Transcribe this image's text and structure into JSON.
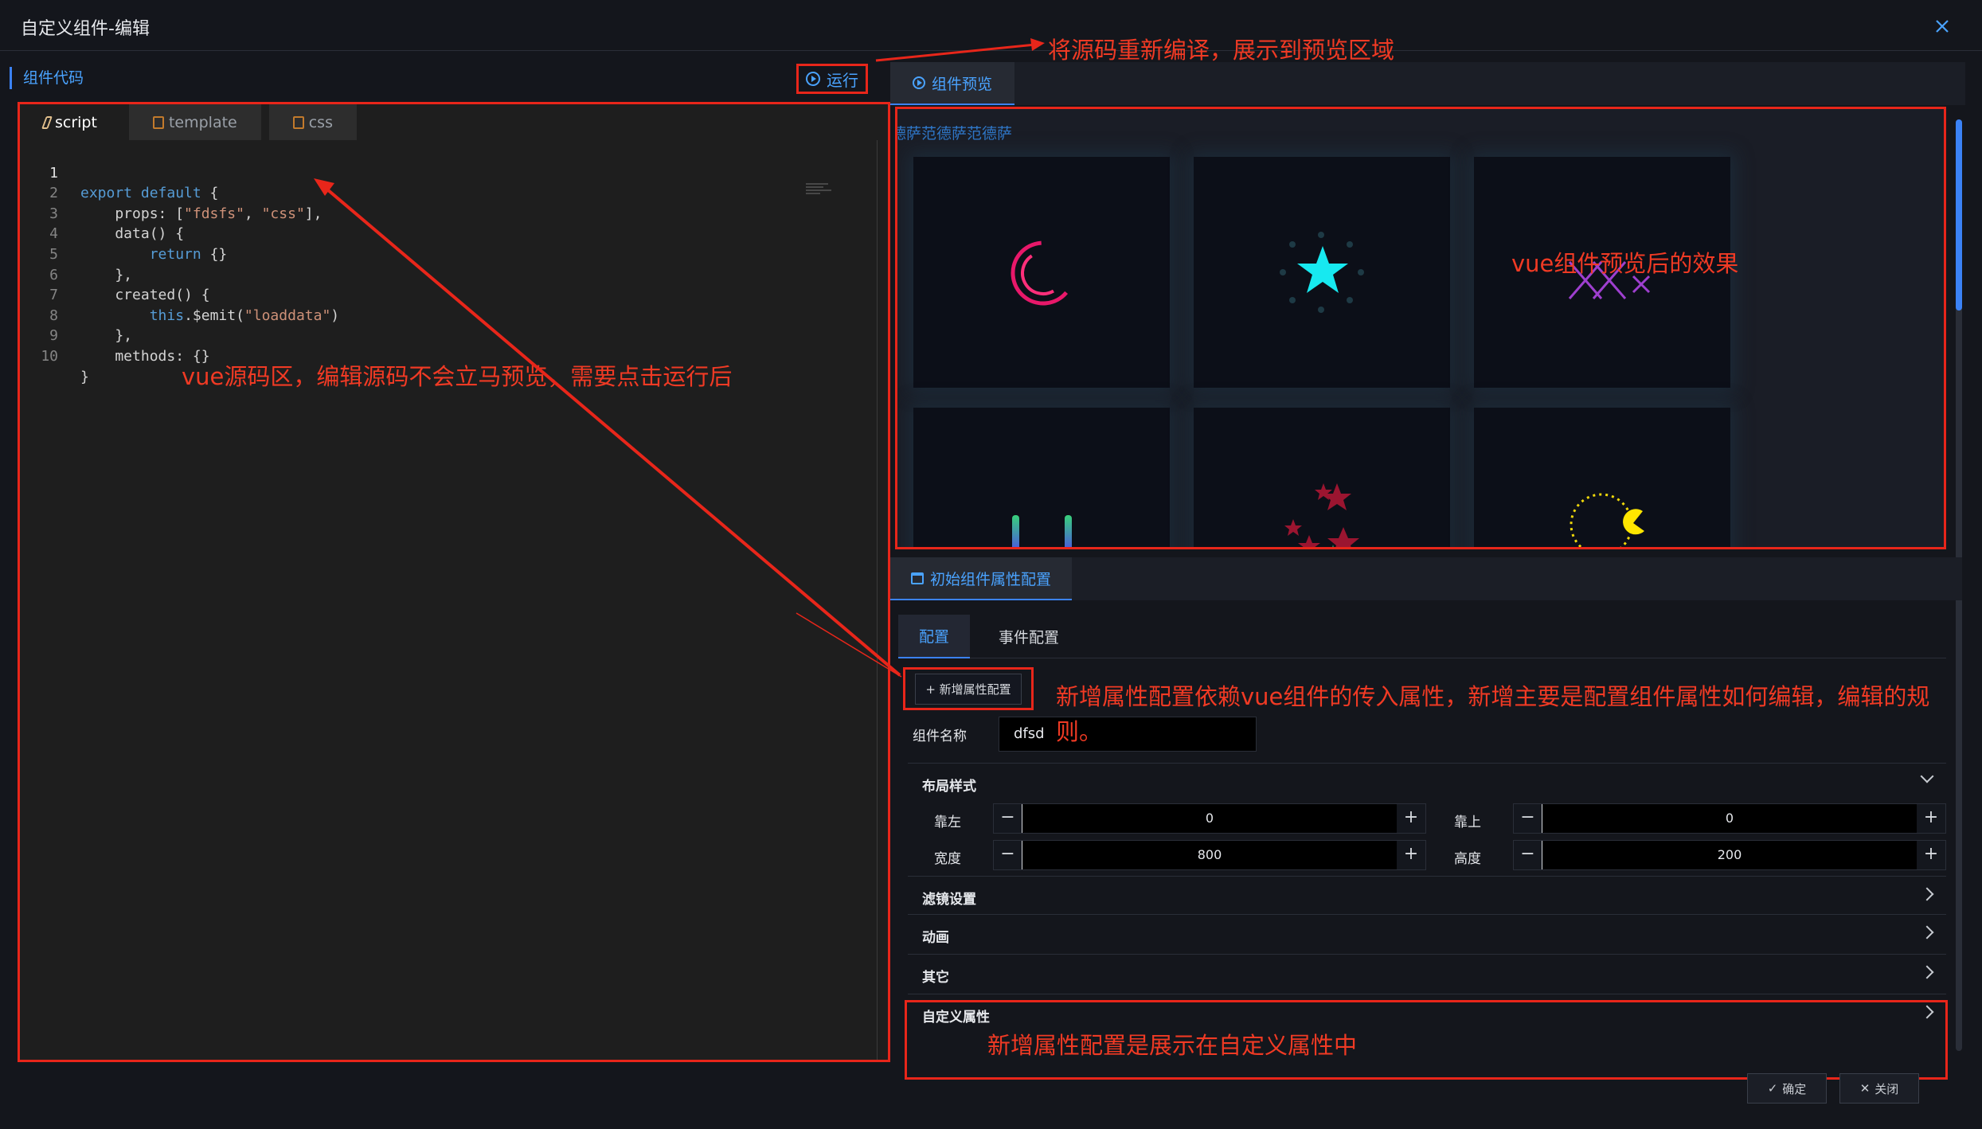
{
  "dialog": {
    "title": "自定义组件-编辑"
  },
  "left": {
    "section_label": "组件代码",
    "run_label": "运行",
    "tabs": [
      {
        "label": "script"
      },
      {
        "label": "template"
      },
      {
        "label": "css"
      }
    ],
    "code_lines": [
      {
        "n": "1",
        "text": "export default {"
      },
      {
        "n": "2",
        "text": "    props: [\"fdsfs\", \"css\"],"
      },
      {
        "n": "3",
        "text": "    data() {"
      },
      {
        "n": "4",
        "text": "        return {}"
      },
      {
        "n": "5",
        "text": "    },"
      },
      {
        "n": "6",
        "text": "    created() {"
      },
      {
        "n": "7",
        "text": "        this.$emit(\"loaddata\")"
      },
      {
        "n": "8",
        "text": "    },"
      },
      {
        "n": "9",
        "text": "    methods: {}"
      },
      {
        "n": "10",
        "text": "}"
      }
    ]
  },
  "right": {
    "preview_tab": "组件预览",
    "preview_text": "德萨范德萨范德萨",
    "config_tab": "初始组件属性配置",
    "subtabs": [
      "配置",
      "事件配置"
    ],
    "add_button": "+ 新增属性配置",
    "name_label": "组件名称",
    "name_value": "dfsd",
    "layout_section": "布局样式",
    "fields": {
      "left_label": "靠左",
      "left_value": "0",
      "top_label": "靠上",
      "top_value": "0",
      "width_label": "宽度",
      "width_value": "800",
      "height_label": "高度",
      "height_value": "200"
    },
    "sections": [
      "滤镜设置",
      "动画",
      "其它",
      "自定义属性"
    ],
    "confirm": "确定",
    "close": "关闭"
  },
  "annotations": {
    "run": "将源码重新编译，展示到预览区域",
    "preview": "vue组件预览后的效果",
    "code": "vue源码区，编辑源码不会立马预览，需要点击运行后",
    "add_line1": "新增属性配置依赖vue组件的传入属性，新增主要是配置组件属性如何编辑，编辑的规",
    "add_line2": "则。",
    "custom": "新增属性配置是展示在自定义属性中"
  },
  "colors": {
    "annotation": "#e8261a",
    "accent": "#4aa3ff",
    "background": "#14161c"
  }
}
